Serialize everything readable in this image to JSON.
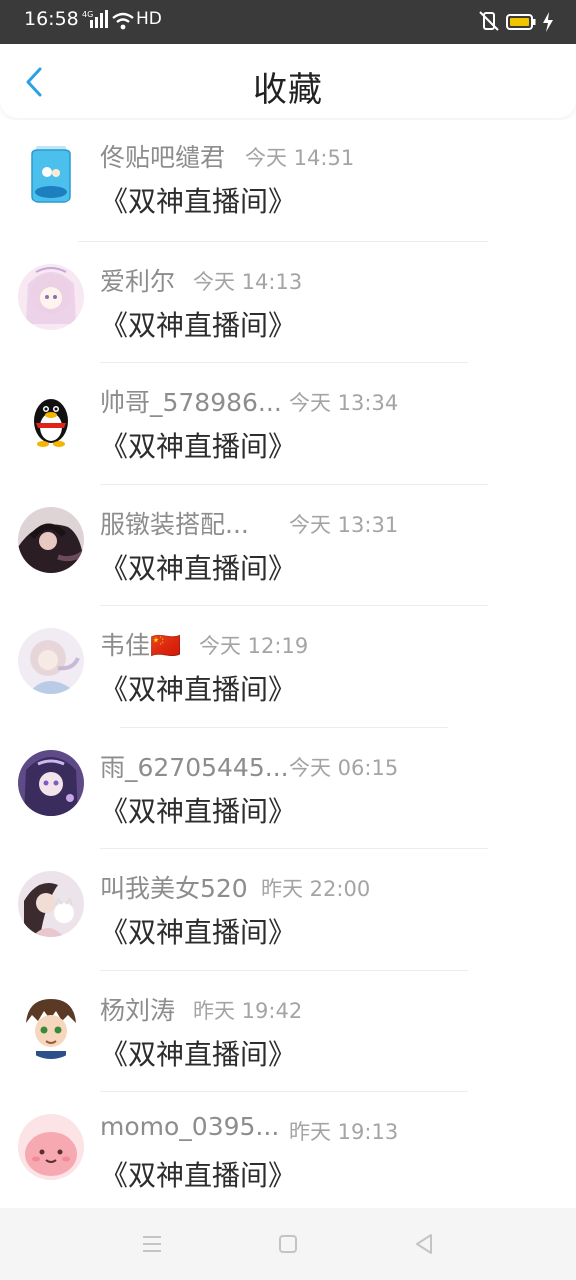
{
  "status_bar": {
    "time": "16:58",
    "network": "4G",
    "label_hd": "HD",
    "battery_color": "#f1c400"
  },
  "header": {
    "title": "收藏",
    "accent_color": "#2aa0e8"
  },
  "items": [
    {
      "user": "佟贴吧缱君",
      "time": "今天 14:51",
      "message": "《双神直播间》",
      "avatar": "jar-avatar"
    },
    {
      "user": "爱利尔",
      "time": "今天 14:13",
      "message": "《双神直播间》",
      "avatar": "anime-girl-avatar"
    },
    {
      "user": "帅哥_578986...",
      "time": "今天 13:34",
      "message": "《双神直播间》",
      "avatar": "penguin-avatar"
    },
    {
      "user": "服镦装搭配...",
      "time": "今天 13:31",
      "message": "《双神直播间》",
      "avatar": "girl-hair-avatar"
    },
    {
      "user": "韦佳🇨🇳",
      "time": "今天 12:19",
      "message": "《双神直播间》",
      "avatar": "light-girl-avatar"
    },
    {
      "user": "雨_62705445...",
      "time": "今天 06:15",
      "message": "《双神直播间》",
      "avatar": "purple-anime-avatar"
    },
    {
      "user": "叫我美女520",
      "time": "昨天 22:00",
      "message": "《双神直播间》",
      "avatar": "girl-cat-avatar"
    },
    {
      "user": "杨刘涛",
      "time": "昨天 19:42",
      "message": "《双神直播间》",
      "avatar": "anime-boy-avatar"
    },
    {
      "user": "momo_0395...",
      "time": "昨天 19:13",
      "message": "《双神直播间》",
      "avatar": "pink-creature-avatar"
    }
  ],
  "nav": {
    "menu_icon": "menu-icon",
    "home_icon": "home-icon",
    "back_icon": "back-triangle-icon"
  }
}
